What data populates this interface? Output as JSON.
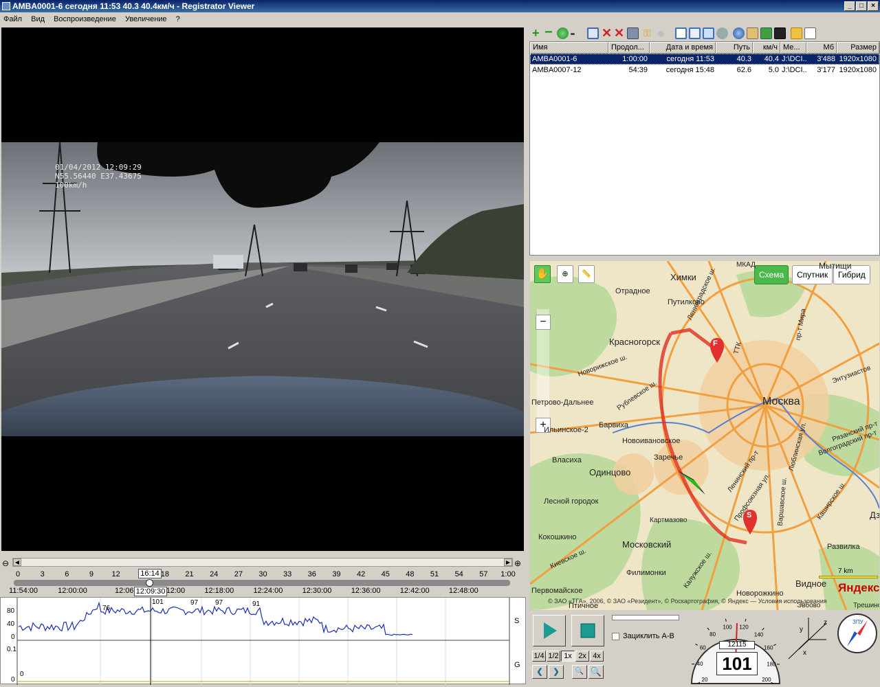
{
  "window": {
    "title": "AMBA0001-6    сегодня 11:53    40.3    40.4км/ч - Registrator Viewer"
  },
  "menu": [
    "Файл",
    "Вид",
    "Воспроизведение",
    "Увеличение",
    "?"
  ],
  "overlay": {
    "line1": "01/04/2012 12:09:29",
    "line2": "N55.56440 E37.43675",
    "line3": "100km/h"
  },
  "files": {
    "columns": [
      "Имя",
      "Продол...",
      "Дата и время",
      "Путь",
      "км/ч",
      "Ме...",
      "Мб",
      "Размер"
    ],
    "rows": [
      [
        "AMBA0001-6",
        "1:00:00",
        "сегодня 11:53",
        "40.3",
        "40.4",
        "J:\\DCI...",
        "3'488",
        "1920x1080"
      ],
      [
        "AMBA0007-12",
        "54:39",
        "сегодня 15:48",
        "62.6",
        "5.0",
        "J:\\DCI...",
        "3'177",
        "1920x1080"
      ]
    ]
  },
  "map": {
    "modes": [
      "Схема",
      "Спутник",
      "Гибрид"
    ],
    "labels": [
      "Химки",
      "Отрадное",
      "Путилково",
      "МКАД",
      "Ленинградское ш.",
      "Мытищи",
      "Красногорск",
      "Москва",
      "пр-т Мира",
      "Энтузиастов",
      "Новорижское ш.",
      "Рублевское ш.",
      "Петрово-Дальнее",
      "ТТК",
      "Рязанский пр-т",
      "Волгоградский пр-т",
      "Ильинское-2",
      "Барвиха",
      "Новоивановское",
      "Заречье",
      "Люблинская ул.",
      "Власиха",
      "Одинцово",
      "Ленинский пр-т",
      "Профсоюзная ул.",
      "Каширское ш.",
      "Лесной городок",
      "Варшавское ш.",
      "Картмазово",
      "Кокошкино",
      "Московский",
      "Развилка",
      "Киевское ш.",
      "Филимонки",
      "Калужское ш.",
      "Видное",
      "Первомайское",
      "Новорожкино",
      "Птичное",
      "Эвбово",
      "Трешино",
      "Дз"
    ],
    "scale": "7 km",
    "copyright": "© ЗАО «ТГА», 2006, © ЗАО «Резидент», © Роскартография, © Яндекс — Условия использования",
    "brand": "Яндекс",
    "start_marker": "S",
    "finish_marker": "F"
  },
  "timeline": {
    "ticks": [
      "0",
      "3",
      "6",
      "9",
      "12",
      "15",
      "18",
      "21",
      "24",
      "27",
      "30",
      "33",
      "36",
      "39",
      "42",
      "45",
      "48",
      "51",
      "54",
      "57",
      "1:00"
    ],
    "cursor_label": "16:14",
    "times": [
      "11:54:00",
      "12:00:00",
      "12:06:00",
      "12:12:00",
      "12:18:00",
      "12:24:00",
      "12:30:00",
      "12:36:00",
      "12:42:00",
      "12:48:00"
    ],
    "cursor_time": "12:09:30",
    "speed_axis": [
      "80",
      "40",
      "0"
    ],
    "speed_peaks": [
      "76",
      "101",
      "97",
      "97",
      "91"
    ],
    "speed_label": "S",
    "g_axis": [
      "0.1",
      "0"
    ],
    "g_label": "G"
  },
  "controls": {
    "loop_label": "Зациклить A-B",
    "speeds": [
      "1/4",
      "1/2",
      "1x",
      "2x",
      "4x"
    ],
    "speed_value": "101",
    "odometer": "12115",
    "dial": [
      "20",
      "40",
      "60",
      "80",
      "100",
      "120",
      "140",
      "160",
      "180",
      "200"
    ],
    "compass": "ЗПУ",
    "axes": {
      "x": "x",
      "y": "y",
      "z": "z"
    }
  }
}
